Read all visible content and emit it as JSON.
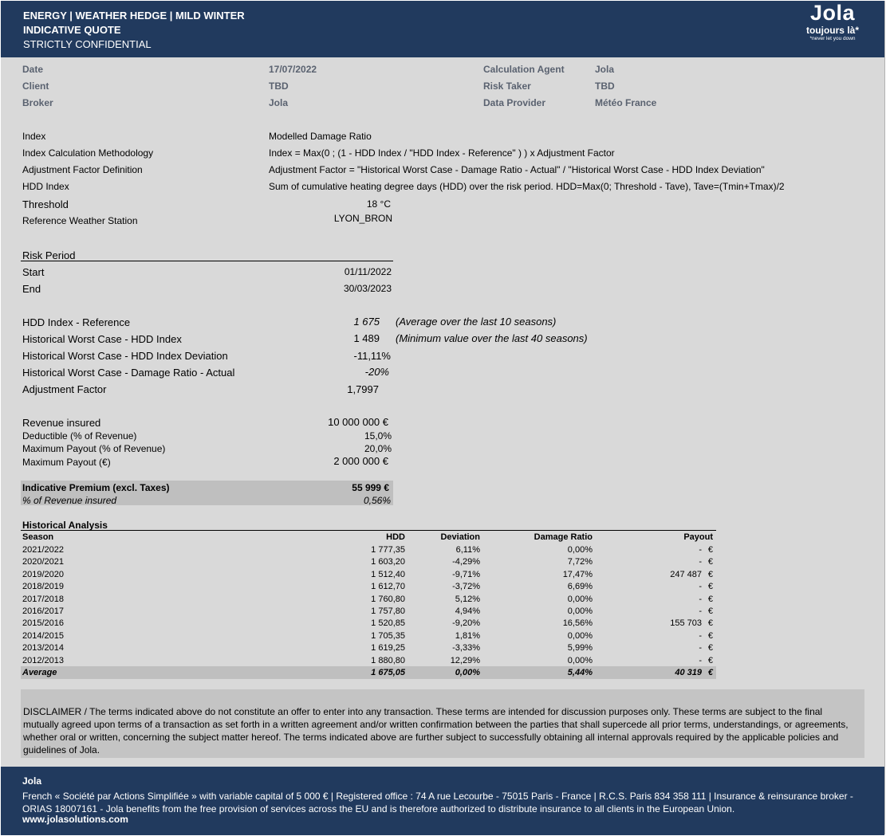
{
  "header": {
    "line1": "ENERGY |  WEATHER HEDGE | MILD WINTER",
    "line2": "INDICATIVE QUOTE",
    "line3": "STRICTLY CONFIDENTIAL",
    "logo_name": "Jola",
    "logo_tagline": "toujours là*",
    "logo_subtagline": "*never let you down"
  },
  "meta": {
    "date_label": "Date",
    "date_value": "17/07/2022",
    "client_label": "Client",
    "client_value": "TBD",
    "broker_label": "Broker",
    "broker_value": "Jola",
    "calc_agent_label": "Calculation Agent",
    "calc_agent_value": "Jola",
    "risk_taker_label": "Risk Taker",
    "risk_taker_value": "TBD",
    "data_provider_label": "Data Provider",
    "data_provider_value": "Météo France"
  },
  "index_section": {
    "index_label": "Index",
    "index_value": "Modelled Damage Ratio",
    "methodology_label": "Index Calculation Methodology",
    "methodology_value": "Index = Max(0 ; (1 - HDD Index  / \"HDD Index - Reference\" ) ) x Adjustment Factor",
    "adj_def_label": "Adjustment Factor Definition",
    "adj_def_value": "Adjustment Factor = \"Historical Worst Case - Damage Ratio - Actual\" / \"Historical Worst Case - HDD Index Deviation\"",
    "hdd_index_label": "HDD Index",
    "hdd_index_value": "Sum of cumulative heating degree days (HDD) over the risk period. HDD=Max(0;  Threshold - Tave), Tave=(Tmin+Tmax)/2",
    "threshold_label": "Threshold",
    "threshold_value": "18 °C",
    "station_label": "Reference Weather Station",
    "station_value": "LYON_BRON"
  },
  "risk_period": {
    "title": "Risk Period",
    "start_label": "Start",
    "start_value": "01/11/2022",
    "end_label": "End",
    "end_value": "30/03/2023"
  },
  "hdd_params": {
    "ref_label": "HDD Index - Reference",
    "ref_value": "1 675",
    "ref_note": "(Average over the last 10 seasons)",
    "worst_label": "Historical Worst Case - HDD Index",
    "worst_value": "1 489",
    "worst_note": "(Minimum value over the last 40 seasons)",
    "dev_label": "Historical Worst Case - HDD Index Deviation",
    "dev_value": "-11,11%",
    "damage_label": "Historical Worst Case - Damage Ratio - Actual",
    "damage_value": "-20%",
    "adj_label": "Adjustment Factor",
    "adj_value": "1,7997"
  },
  "financials": {
    "revenue_label": "Revenue insured",
    "revenue_value": "10 000 000 €",
    "deductible_label": "Deductible (% of Revenue)",
    "deductible_value": "15,0%",
    "max_pct_label": "Maximum Payout (% of Revenue)",
    "max_pct_value": "20,0%",
    "max_eur_label": "Maximum Payout (€)",
    "max_eur_value": "2 000 000 €",
    "premium_label": "Indicative Premium (excl. Taxes)",
    "premium_value": "55 999 €",
    "premium_pct_label": "% of Revenue insured",
    "premium_pct_value": "0,56%"
  },
  "historical": {
    "title": "Historical Analysis",
    "headers": [
      "Season",
      "HDD",
      "Deviation",
      "Damage Ratio",
      "Payout"
    ],
    "rows": [
      [
        "2021/2022",
        "1 777,35",
        "6,11%",
        "0,00%",
        "-",
        "€"
      ],
      [
        "2020/2021",
        "1 603,20",
        "-4,29%",
        "7,72%",
        "-",
        "€"
      ],
      [
        "2019/2020",
        "1 512,40",
        "-9,71%",
        "17,47%",
        "247 487",
        "€"
      ],
      [
        "2018/2019",
        "1 612,70",
        "-3,72%",
        "6,69%",
        "-",
        "€"
      ],
      [
        "2017/2018",
        "1 760,80",
        "5,12%",
        "0,00%",
        "-",
        "€"
      ],
      [
        "2016/2017",
        "1 757,80",
        "4,94%",
        "0,00%",
        "-",
        "€"
      ],
      [
        "2015/2016",
        "1 520,85",
        "-9,20%",
        "16,56%",
        "155 703",
        "€"
      ],
      [
        "2014/2015",
        "1 705,35",
        "1,81%",
        "0,00%",
        "-",
        "€"
      ],
      [
        "2013/2014",
        "1 619,25",
        "-3,33%",
        "5,99%",
        "-",
        "€"
      ],
      [
        "2012/2013",
        "1 880,80",
        "12,29%",
        "0,00%",
        "-",
        "€"
      ]
    ],
    "average": [
      "Average",
      "1 675,05",
      "0,00%",
      "5,44%",
      "40 319",
      "€"
    ]
  },
  "disclaimer": "DISCLAIMER / The terms indicated above do not constitute an offer to enter into any transaction. These terms are intended for discussion purposes only. These terms are subject to the final mutually agreed upon terms of a transaction as set forth in a written agreement and/or written confirmation between the parties that shall supercede all prior terms, understandings, or agreements, whether oral or written, concerning the subject matter hereof.  The terms indicated above are further subject to successfully obtaining all internal approvals required by the applicable policies and guidelines of Jola.",
  "footer": {
    "company": "Jola",
    "legal": "French « Société par Actions Simplifiée » with variable capital of 5 000 € | Registered office : 74 A rue Lecourbe - 75015 Paris - France | R.C.S. Paris 834 358 111 | Insurance & reinsurance broker - ORIAS 18007161 - Jola benefits from the free provision of services across the EU and is therefore authorized to distribute insurance to all clients in the European Union.",
    "website": "www.jolasolutions.com"
  }
}
